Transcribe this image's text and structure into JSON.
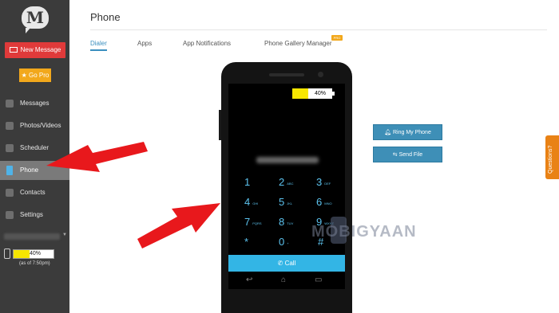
{
  "sidebar": {
    "logo_letter": "M",
    "new_message_label": "New Message",
    "go_pro_label": "★ Go Pro",
    "items": [
      {
        "label": "Messages"
      },
      {
        "label": "Photos/Videos"
      },
      {
        "label": "Scheduler"
      },
      {
        "label": "Phone"
      },
      {
        "label": "Contacts"
      },
      {
        "label": "Settings"
      }
    ],
    "battery_text": "40%",
    "battery_level": 0.4,
    "as_of": "(as of 7:50pm)"
  },
  "main": {
    "title": "Phone",
    "tabs": [
      {
        "label": "Dialer"
      },
      {
        "label": "Apps"
      },
      {
        "label": "App Notifications"
      },
      {
        "label": "Phone Gallery Manager"
      }
    ],
    "pro_badge": "PRO"
  },
  "phone": {
    "battery_text": "40%",
    "battery_level": 0.4,
    "keys": [
      {
        "digit": "1",
        "letters": ""
      },
      {
        "digit": "2",
        "letters": "ABC"
      },
      {
        "digit": "3",
        "letters": "DEF"
      },
      {
        "digit": "4",
        "letters": "GHI"
      },
      {
        "digit": "5",
        "letters": "JKL"
      },
      {
        "digit": "6",
        "letters": "MNO"
      },
      {
        "digit": "7",
        "letters": "PQRS"
      },
      {
        "digit": "8",
        "letters": "TUV"
      },
      {
        "digit": "9",
        "letters": "WXYZ"
      },
      {
        "digit": "*",
        "letters": ""
      },
      {
        "digit": "0",
        "letters": "+"
      },
      {
        "digit": "#",
        "letters": ""
      }
    ],
    "call_label": "Call"
  },
  "actions": {
    "ring_label": "Ring My Phone",
    "send_file_label": "Send File"
  },
  "questions_label": "Questions?",
  "watermark": "MOBIGYAAN",
  "colors": {
    "sidebar_bg": "#3b3b3b",
    "new_message": "#e03a3a",
    "go_pro": "#f2a81c",
    "accent": "#3a8fbf",
    "call_bar": "#33b5e5",
    "arrow": "#e8181c",
    "questions_tab": "#e98215"
  }
}
